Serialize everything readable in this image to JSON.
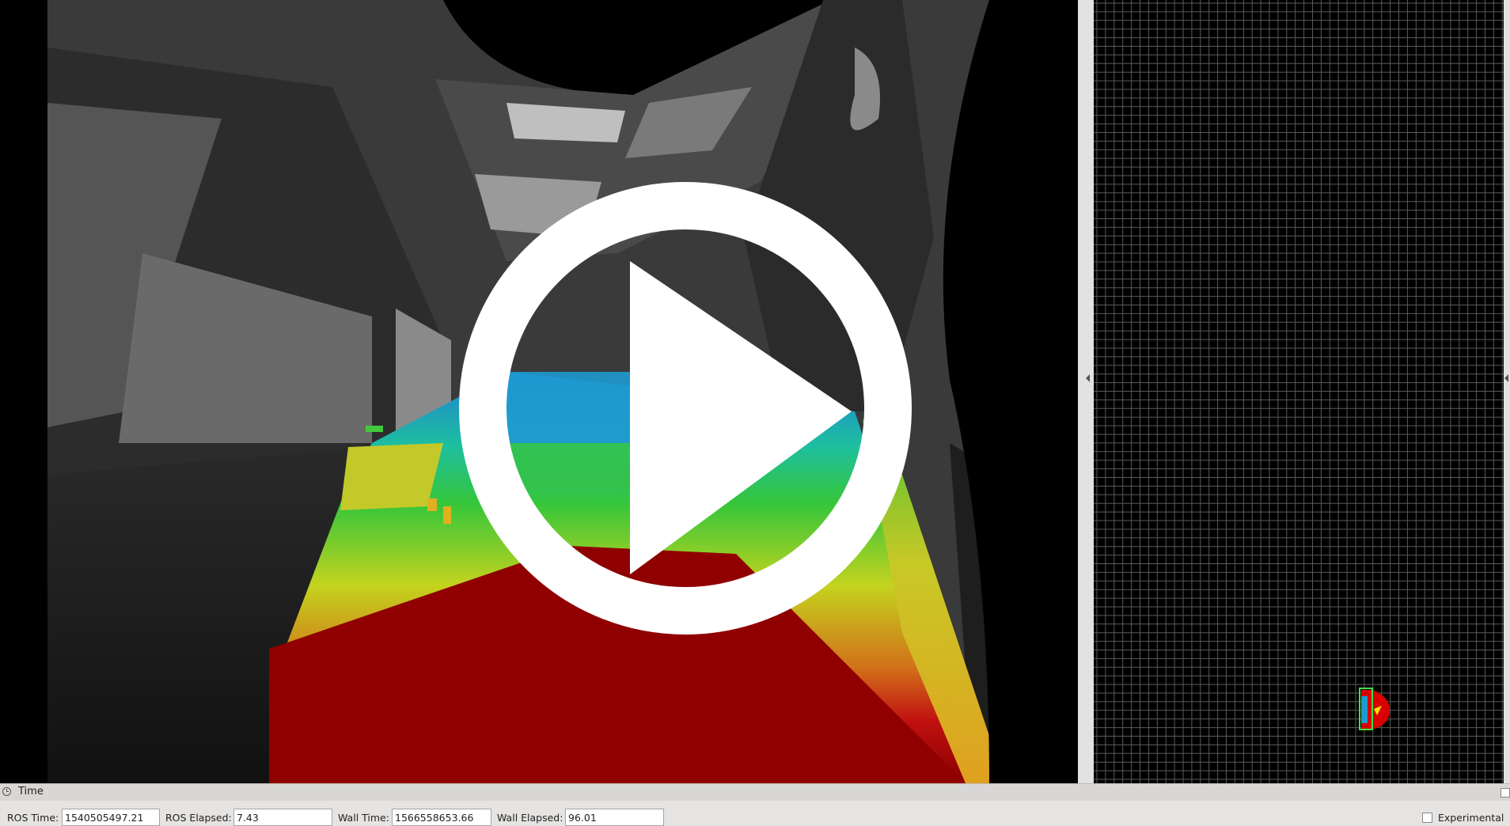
{
  "time_panel": {
    "title": "Time",
    "ros_time_label": "ROS Time:",
    "ros_time_value": "1540505497.21",
    "ros_elapsed_label": "ROS Elapsed:",
    "ros_elapsed_value": "7.43",
    "wall_time_label": "Wall Time:",
    "wall_time_value": "1566558653.66",
    "wall_elapsed_label": "Wall Elapsed:",
    "wall_elapsed_value": "96.01",
    "experimental_label": "Experimental",
    "experimental_checked": false
  },
  "icons": {
    "time_panel": "clock-icon",
    "overlay": "play-icon",
    "splitter": "collapse-arrow-icon"
  },
  "colors": {
    "panel_bg": "#e4e2e0",
    "grid_line": "#5a5a5a",
    "depth_near": "#b30000",
    "depth_mid": "#c8d21e",
    "depth_far": "#1e8ad2",
    "overlay": "#ffffff"
  }
}
